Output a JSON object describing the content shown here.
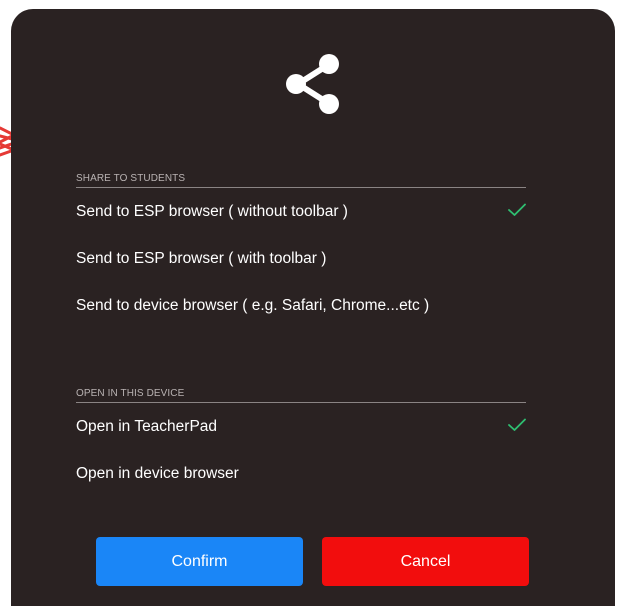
{
  "dialog": {
    "icon": "share-icon",
    "sections": [
      {
        "header": "SHARE TO STUDENTS",
        "options": [
          {
            "label": "Send to ESP browser ( without toolbar )",
            "selected": true
          },
          {
            "label": "Send to ESP browser ( with toolbar )",
            "selected": false
          },
          {
            "label": "Send to device browser ( e.g. Safari, Chrome...etc )",
            "selected": false
          }
        ]
      },
      {
        "header": "OPEN IN THIS DEVICE",
        "options": [
          {
            "label": "Open in TeacherPad",
            "selected": true
          },
          {
            "label": "Open in device browser",
            "selected": false
          }
        ]
      }
    ],
    "buttons": {
      "confirm_label": "Confirm",
      "cancel_label": "Cancel"
    }
  },
  "colors": {
    "dialog_bg": "#2a2222",
    "check": "#2fbf71",
    "confirm": "#1a86f7",
    "cancel": "#f20d0d",
    "edge_arrow": "#e53935"
  }
}
